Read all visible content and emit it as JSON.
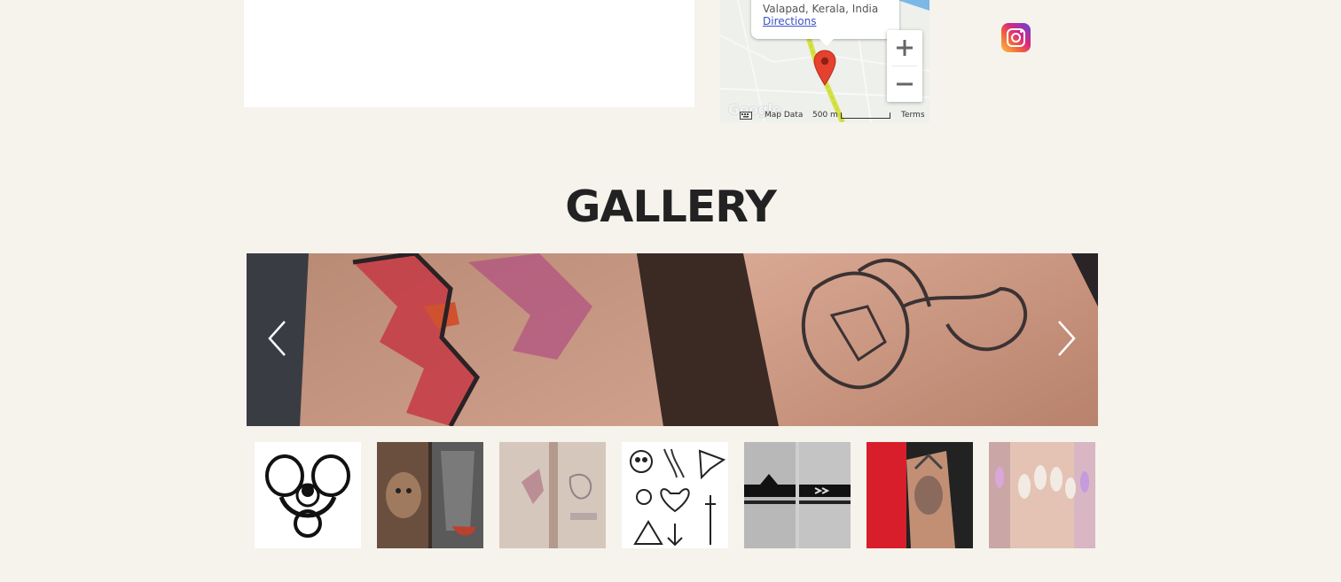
{
  "map": {
    "address": "Valapad, Kerala, India",
    "directions_label": "Directions",
    "zoom_in_label": "+",
    "zoom_out_label": "−",
    "map_data_label": "Map Data",
    "scale_label": "500 m",
    "terms_label": "Terms",
    "google_logo_text": "Google"
  },
  "social": {
    "instagram_icon": "instagram-icon"
  },
  "gallery": {
    "title": "GALLERY",
    "prev_icon": "chevron-left-icon",
    "next_icon": "chevron-right-icon",
    "thumbnails": [
      "tribal biohazard tattoo design",
      "dog portrait forearm tattoo",
      "faded forearm tattoos",
      "assorted tattoo flash sheet",
      "black armband tattoos",
      "woman portrait forearm tattoo",
      "nail art"
    ]
  },
  "colors": {
    "page_background": "#f6f3ec",
    "title_color": "#222222",
    "map_marker": "#e5412e"
  }
}
